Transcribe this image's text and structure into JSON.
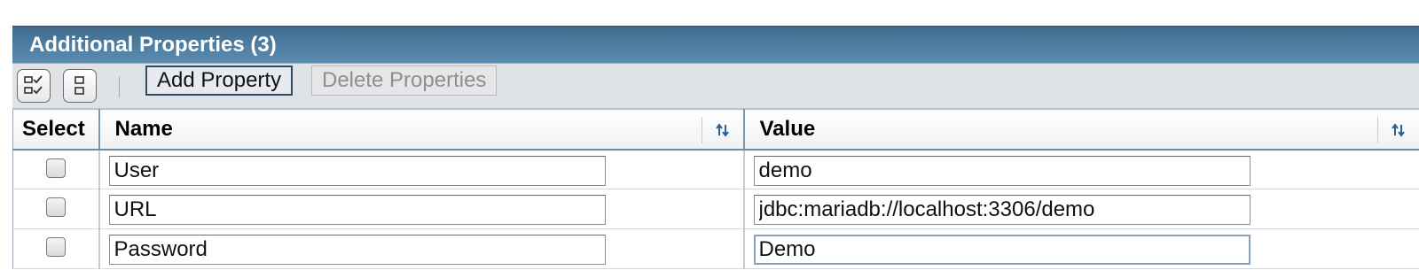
{
  "panel": {
    "title": "Additional Properties (3)"
  },
  "toolbar": {
    "select_all_icon": "select-all-icon",
    "deselect_all_icon": "deselect-all-icon",
    "add_label": "Add Property",
    "delete_label": "Delete Properties"
  },
  "table": {
    "columns": {
      "select": "Select",
      "name": "Name",
      "value": "Value"
    },
    "rows": [
      {
        "checked": false,
        "name": "User",
        "value": "demo"
      },
      {
        "checked": false,
        "name": "URL",
        "value": "jdbc:mariadb://localhost:3306/demo"
      },
      {
        "checked": false,
        "name": "Password",
        "value": "Demo"
      }
    ]
  },
  "colors": {
    "title_bar": "#4f7fa3",
    "toolbar_bg": "#dfe3e8",
    "header_border": "#6f8aa3"
  }
}
